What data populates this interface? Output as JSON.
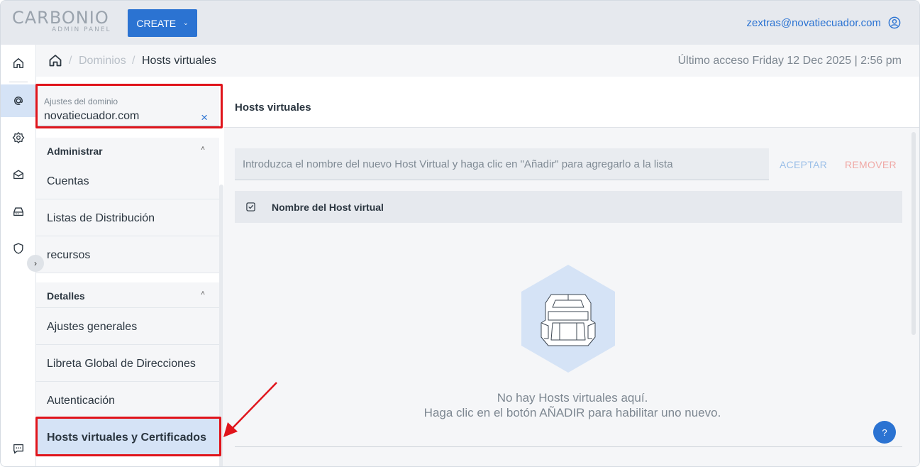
{
  "header": {
    "logo_brand": "CARBONIO",
    "logo_sub": "ADMIN PANEL",
    "create_label": "CREATE",
    "user_email": "zextras@novatiecuador.com"
  },
  "rail": {
    "icons": [
      "home-icon",
      "at-icon",
      "gear-icon",
      "mailbox-icon",
      "storage-icon",
      "shield-icon",
      "chat-icon"
    ],
    "expand_label": "›"
  },
  "breadcrumb": {
    "sep": "/",
    "domains": "Dominios",
    "current": "Hosts virtuales",
    "last_access": "Último acceso Friday 12 Dec 2025 | 2:56 pm"
  },
  "sidepanel": {
    "domain_label": "Ajustes del dominio",
    "domain_value": "novatiecuador.com",
    "clear_icon": "×",
    "sections": [
      {
        "title": "Administrar",
        "items": [
          "Cuentas",
          "Listas de Distribución",
          "recursos"
        ]
      },
      {
        "title": "Detalles",
        "items": [
          "Ajustes generales",
          "Libreta Global de Direcciones",
          "Autenticación",
          "Hosts virtuales y Certificados"
        ]
      }
    ],
    "collapse_icon": "˄"
  },
  "main": {
    "title": "Hosts virtuales",
    "input_placeholder": "Introduzca el nombre del nuevo Host Virtual y haga clic en \"Añadir\" para agregarlo a la lista",
    "accept_label": "ACEPTAR",
    "remove_label": "REMOVER",
    "column_header": "Nombre del Host virtual",
    "empty_line1": "No hay Hosts virtuales aquí.",
    "empty_line2": "Haga clic en el botón AÑADIR para habilitar uno nuevo.",
    "help_label": "?"
  },
  "colors": {
    "accent": "#2b73d2",
    "highlight": "#e0141b",
    "selected_bg": "#d5e3f6"
  }
}
